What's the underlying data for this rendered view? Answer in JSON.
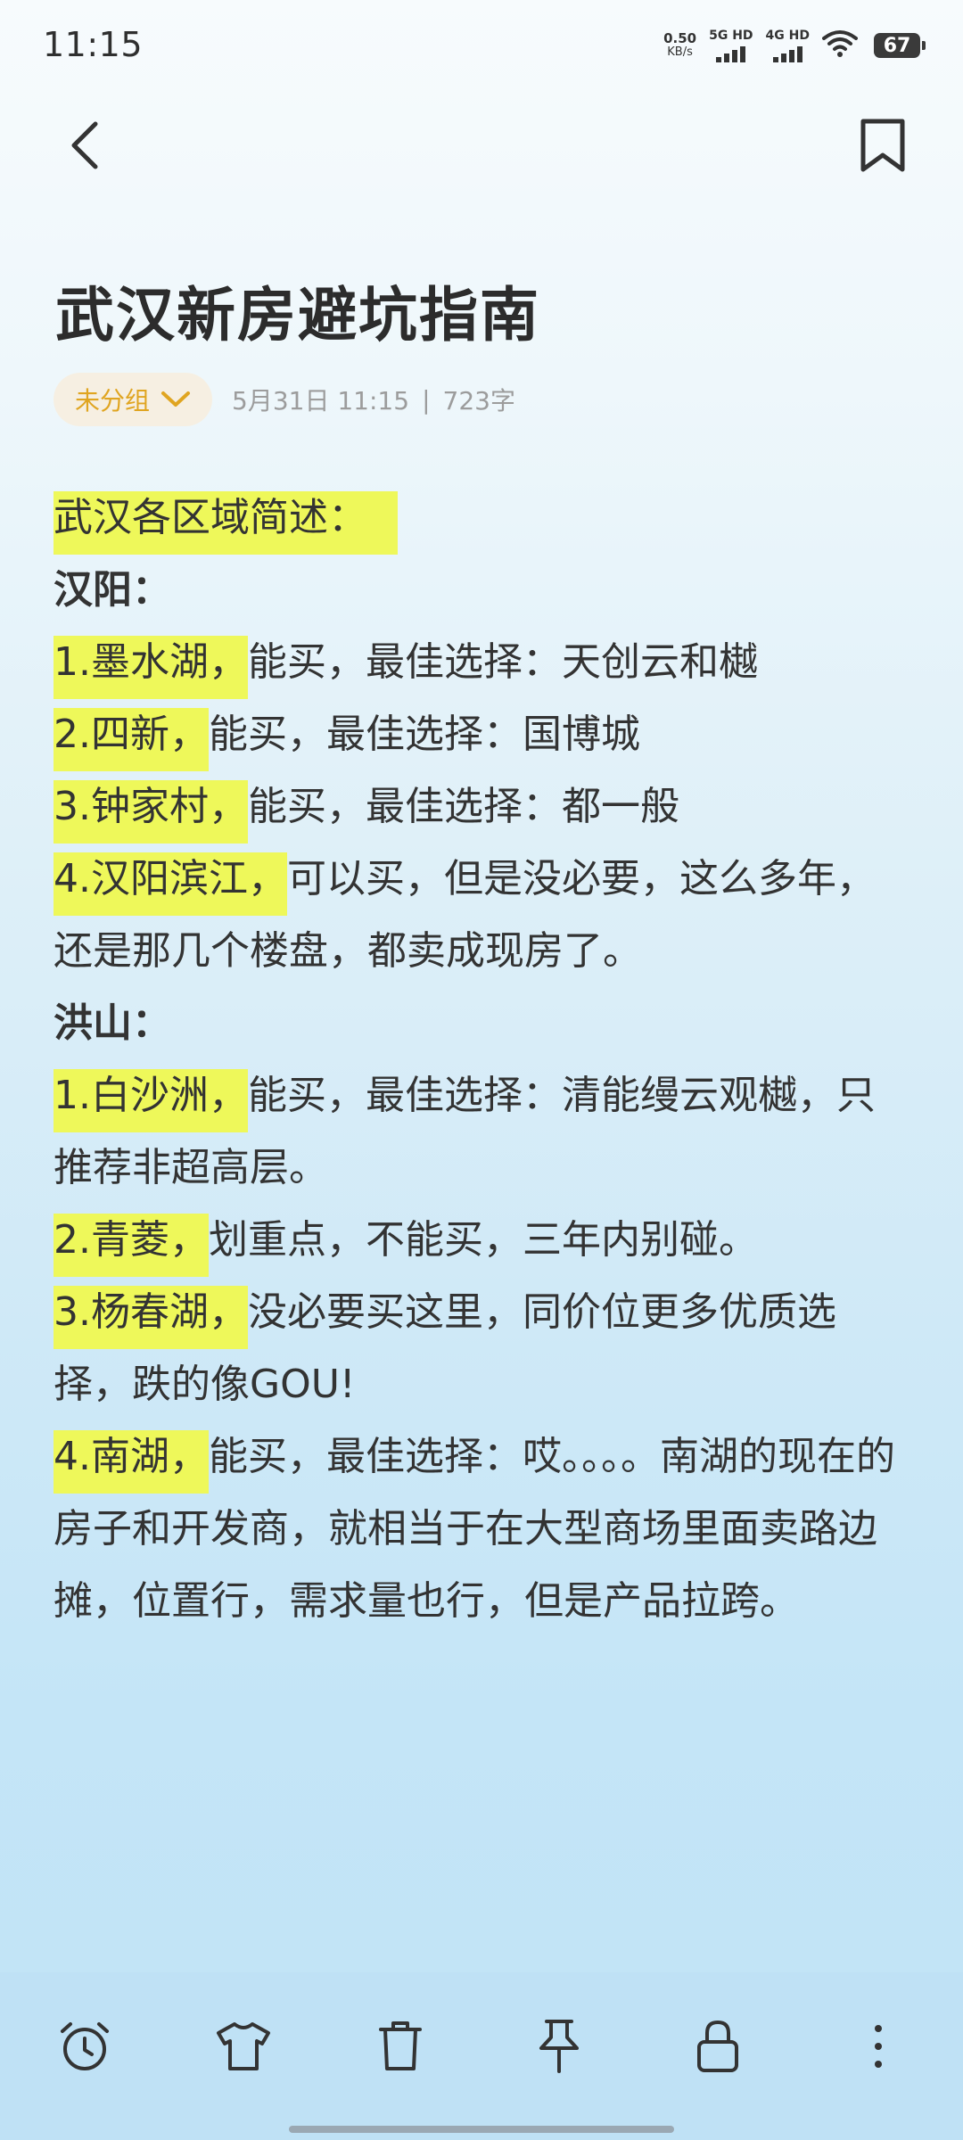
{
  "status_bar": {
    "time": "11:15",
    "net_speed_value": "0.50",
    "net_speed_unit": "KB/s",
    "sim1_label": "5G HD",
    "sim2_label": "4G HD",
    "battery": "67"
  },
  "nav": {
    "back_icon": "chevron-left-icon",
    "bookmark_icon": "bookmark-icon"
  },
  "note": {
    "title": "武汉新房避坑指南",
    "group_label": "未分组",
    "date": "5月31日 11:15",
    "separator": "|",
    "word_count": "723字",
    "intro_highlight": "武汉各区域简述：",
    "hanyang_heading": "汉阳：",
    "hanyang_items": [
      {
        "hl": "1.墨水湖，",
        "text": "能买，最佳选择：天创云和樾"
      },
      {
        "hl": "2.四新，",
        "text": "能买，最佳选择：国博城"
      },
      {
        "hl": "3.钟家村，",
        "text": "能买，最佳选择：都一般"
      },
      {
        "hl": "4.汉阳滨江，",
        "text": "可以买，但是没必要，这么多年，还是那几个楼盘，都卖成现房了。"
      }
    ],
    "hongshan_heading": "洪山：",
    "hongshan_items": [
      {
        "hl": "1.白沙洲，",
        "text": "能买，最佳选择：清能缦云观樾，只推荐非超高层。"
      },
      {
        "hl": "2.青菱，",
        "text": "划重点，不能买，三年内别碰。"
      },
      {
        "hl": "3.杨春湖，",
        "text": "没必要买这里，同价位更多优质选择，跌的像GOU!"
      },
      {
        "hl": "4.南湖，",
        "text": "能买，最佳选择：哎。。。。南湖的现在的房子和开发商，就相当于在大型商场里面卖路边摊，位置行，需求量也行，但是产品拉跨。"
      }
    ]
  },
  "toolbar": {
    "icons": [
      "alarm-clock-icon",
      "tshirt-icon",
      "trash-icon",
      "pin-icon",
      "lock-icon",
      "more-vertical-icon"
    ]
  },
  "colors": {
    "highlight": "#eef85a",
    "accent": "#e0a521",
    "text": "#333333",
    "meta": "#9c9c9c"
  }
}
